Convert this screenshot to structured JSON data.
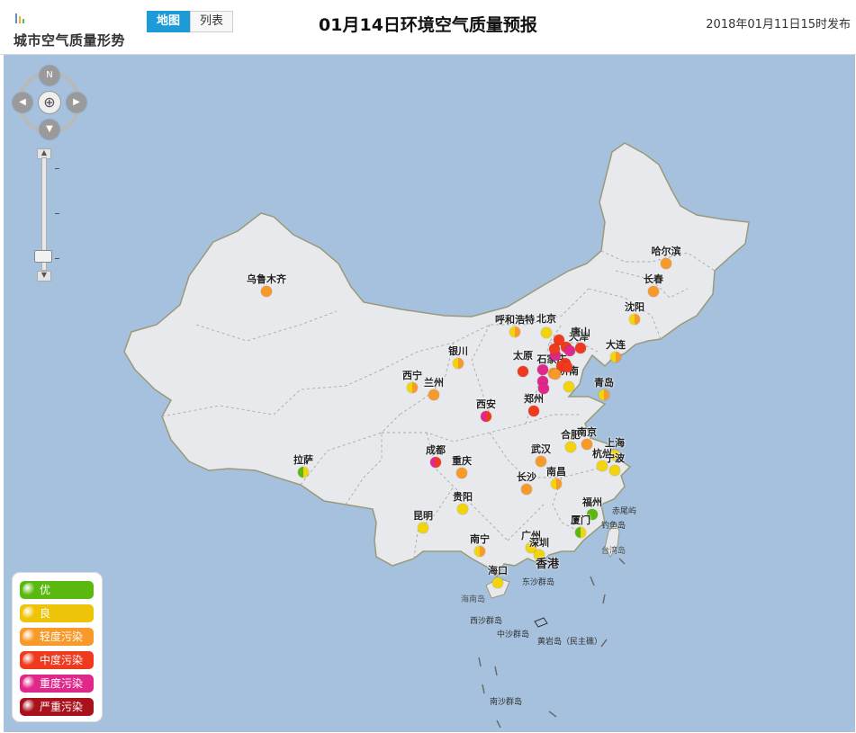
{
  "header": {
    "brand": "城市空气质量形势",
    "tabs": [
      {
        "label": "地图",
        "active": true
      },
      {
        "label": "列表",
        "active": false
      }
    ],
    "title": "01月14日环境空气质量预报",
    "publish": "2018年01月11日15时发布"
  },
  "colors": {
    "good": "#5ab90f",
    "fine": "#f2d40d",
    "light": "#f79a2a",
    "moderate": "#f03a1e",
    "heavy": "#e0288a",
    "severe": "#a8121c",
    "tab_active": "#1d9bd8",
    "sea": "#a5c1de",
    "land": "#e7e9ed"
  },
  "nav": {
    "north_label": "N"
  },
  "legend": [
    {
      "label": "优",
      "color": "#5ab90f"
    },
    {
      "label": "良",
      "color": "#eec409"
    },
    {
      "label": "轻度污染",
      "color": "#f79a2a"
    },
    {
      "label": "中度污染",
      "color": "#f03a1e"
    },
    {
      "label": "重度污染",
      "color": "#e0288a"
    },
    {
      "label": "严重污染",
      "color": "#a8121c"
    }
  ],
  "cities": [
    {
      "name": "乌鲁木齐",
      "level": "light"
    },
    {
      "name": "哈尔滨",
      "level": "light"
    },
    {
      "name": "长春",
      "level": "light"
    },
    {
      "name": "沈阳",
      "level": "fine-light"
    },
    {
      "name": "呼和浩特",
      "level": "fine-light"
    },
    {
      "name": "北京",
      "level": "fine"
    },
    {
      "name": "天津",
      "level": "moderate"
    },
    {
      "name": "唐山",
      "level": "moderate"
    },
    {
      "name": "大连",
      "level": "fine-light"
    },
    {
      "name": "银川",
      "level": "fine-light"
    },
    {
      "name": "太原",
      "level": "moderate"
    },
    {
      "name": "石家庄",
      "level": "heavy"
    },
    {
      "name": "济南",
      "level": "fine"
    },
    {
      "name": "西宁",
      "level": "fine-light"
    },
    {
      "name": "兰州",
      "level": "light"
    },
    {
      "name": "青岛",
      "level": "fine-light"
    },
    {
      "name": "西安",
      "level": "heavy-moderate"
    },
    {
      "name": "郑州",
      "level": "moderate"
    },
    {
      "name": "合肥",
      "level": "fine"
    },
    {
      "name": "南京",
      "level": "light"
    },
    {
      "name": "上海",
      "level": "fine"
    },
    {
      "name": "拉萨",
      "level": "good-fine"
    },
    {
      "name": "成都",
      "level": "heavy-moderate"
    },
    {
      "name": "重庆",
      "level": "light"
    },
    {
      "name": "武汉",
      "level": "light"
    },
    {
      "name": "杭州",
      "level": "fine"
    },
    {
      "name": "宁波",
      "level": "fine"
    },
    {
      "name": "长沙",
      "level": "light"
    },
    {
      "name": "南昌",
      "level": "fine-light"
    },
    {
      "name": "贵阳",
      "level": "fine"
    },
    {
      "name": "福州",
      "level": "good"
    },
    {
      "name": "厦门",
      "level": "good-fine"
    },
    {
      "name": "昆明",
      "level": "fine"
    },
    {
      "name": "南宁",
      "level": "fine-light"
    },
    {
      "name": "广州",
      "level": "fine"
    },
    {
      "name": "深圳",
      "level": "fine"
    },
    {
      "name": "海口",
      "level": "fine"
    }
  ],
  "extra_points": [
    "moderate",
    "heavy",
    "heavy",
    "moderate",
    "moderate",
    "light",
    "moderate",
    "heavy",
    "heavy",
    "light",
    "moderate"
  ],
  "map_labels": {
    "hongkong": "香港",
    "hainan": "海南岛",
    "dongsha": "东沙群岛",
    "xisha": "西沙群岛",
    "zhongsha": "中沙群岛",
    "huangyan": "黄岩岛（民主礁）",
    "nansha": "南沙群岛",
    "chiwei": "赤尾屿",
    "diaoyu": "钓鱼岛",
    "taiwan": "台湾岛"
  }
}
